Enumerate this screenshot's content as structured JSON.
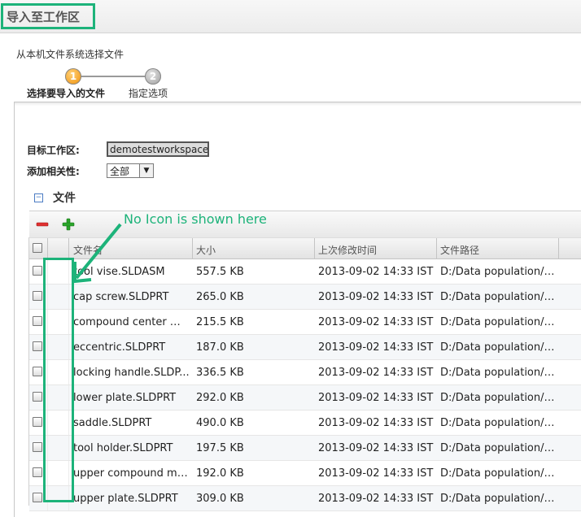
{
  "window": {
    "title": "导入至工作区"
  },
  "wizard": {
    "subtitle": "从本机文件系统选择文件",
    "steps": [
      {
        "number": "1",
        "label": "选择要导入的文件",
        "active": true
      },
      {
        "number": "2",
        "label": "指定选项",
        "active": false
      }
    ]
  },
  "form": {
    "workspace_label": "目标工作区:",
    "workspace_value": "demotestworkspace",
    "dependencies_label": "添加相关性:",
    "dependencies_value": "全部"
  },
  "files": {
    "section_title": "文件",
    "toolbar": {
      "remove_icon": "minus-icon",
      "add_icon": "plus-icon"
    },
    "columns": [
      "文件名",
      "大小",
      "上次修改时间",
      "文件路径"
    ],
    "rows": [
      {
        "name": "tool vise.SLDASM",
        "size": "557.5 KB",
        "modified": "2013-09-02 14:33 IST",
        "path": "D:/Data population/R..."
      },
      {
        "name": "cap screw.SLDPRT",
        "size": "265.0 KB",
        "modified": "2013-09-02 14:33 IST",
        "path": "D:/Data population/R..."
      },
      {
        "name": "compound center me...",
        "size": "215.5 KB",
        "modified": "2013-09-02 14:33 IST",
        "path": "D:/Data population/R..."
      },
      {
        "name": "eccentric.SLDPRT",
        "size": "187.0 KB",
        "modified": "2013-09-02 14:33 IST",
        "path": "D:/Data population/R..."
      },
      {
        "name": "locking handle.SLDP...",
        "size": "336.5 KB",
        "modified": "2013-09-02 14:33 IST",
        "path": "D:/Data population/R..."
      },
      {
        "name": "lower plate.SLDPRT",
        "size": "292.0 KB",
        "modified": "2013-09-02 14:33 IST",
        "path": "D:/Data population/R..."
      },
      {
        "name": "saddle.SLDPRT",
        "size": "490.0 KB",
        "modified": "2013-09-02 14:33 IST",
        "path": "D:/Data population/R..."
      },
      {
        "name": "tool holder.SLDPRT",
        "size": "197.5 KB",
        "modified": "2013-09-02 14:33 IST",
        "path": "D:/Data population/R..."
      },
      {
        "name": "upper compound me...",
        "size": "192.0 KB",
        "modified": "2013-09-02 14:33 IST",
        "path": "D:/Data population/R..."
      },
      {
        "name": "upper plate.SLDPRT",
        "size": "309.0 KB",
        "modified": "2013-09-02 14:33 IST",
        "path": "D:/Data population/R..."
      }
    ]
  },
  "annotation": {
    "text": "No Icon is shown here",
    "color": "#1db37a"
  },
  "colors": {
    "accent": "#1db37a",
    "active_step": "#f08c00",
    "remove": "#e03030",
    "add": "#2aa52a"
  }
}
